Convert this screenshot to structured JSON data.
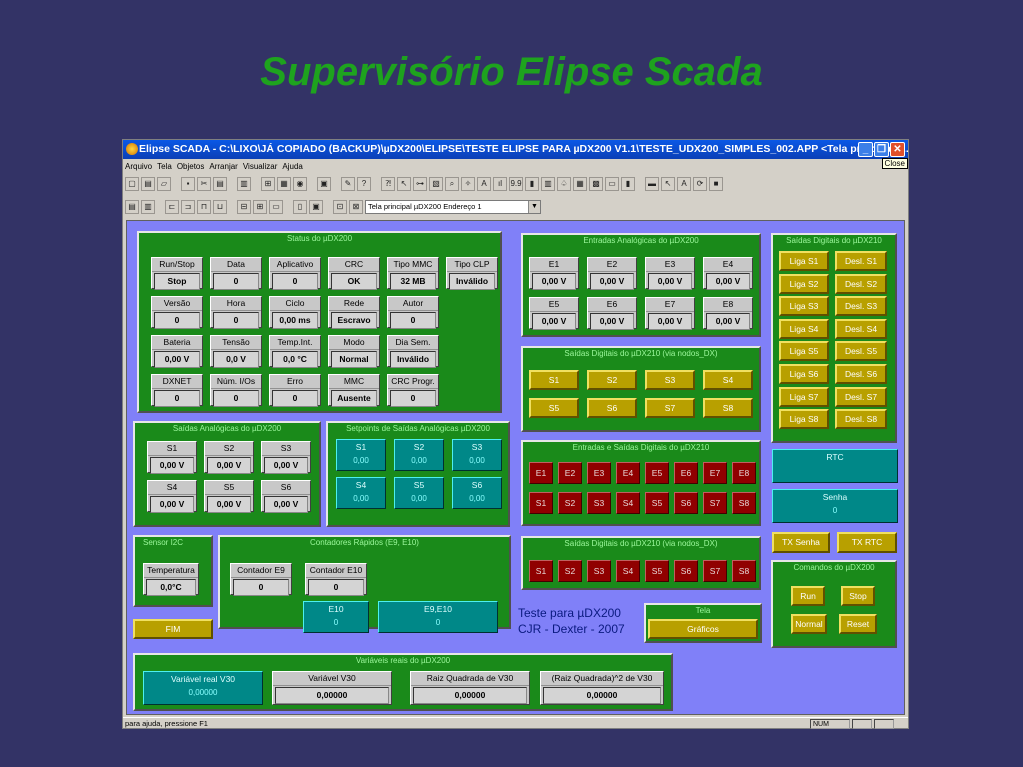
{
  "slide": {
    "title": "Supervisório Elipse Scada"
  },
  "window": {
    "title": "Elipse SCADA - C:\\LIXO\\JÁ COPIADO (BACKUP)\\µDX200\\ELIPSE\\TESTE ELIPSE PARA µDX200 V1.1\\TESTE_UDX200_SIMPLES_002.APP <Tela principal µ...",
    "minimize": "_",
    "maximize": "❐",
    "close": "✕",
    "close_tooltip": "Close",
    "menu": [
      "Arquivo",
      "Tela",
      "Objetos",
      "Arranjar",
      "Visualizar",
      "Ajuda"
    ],
    "screen_select": "Tela principal µDX200 Endereço 1",
    "status_text": "para ajuda, pressione F1",
    "status_num": "NUM"
  },
  "toolbar1_icons": [
    "new-screen-icon",
    "new-file-icon",
    "open-icon",
    "save-icon",
    "cut-icon",
    "copy-icon",
    "paste-icon",
    "tags-icon",
    "print-preview-icon",
    "camera-icon",
    "app-browser-icon",
    "tools-icon",
    "help-icon",
    "context-help-icon",
    "pointer-icon",
    "button-tool-icon",
    "gauge-tool-icon",
    "display-tool-icon",
    "animation-tool-icon",
    "text-tool-icon",
    "bar-tool-icon",
    "value-tool-icon",
    "table-tool-icon",
    "trend-tool-icon",
    "alarm-tool-icon",
    "browser-tool-icon",
    "picture-tool-icon",
    "setpoint-tool-icon",
    "video-tool-icon",
    "slider-tool-icon",
    "cursor-disabled-icon",
    "text-disabled-icon",
    "rotate-disabled-icon",
    "stop-disabled-icon"
  ],
  "toolbar1_glyphs": [
    "▢",
    "▤",
    "▱",
    "▪",
    "✂",
    "▤",
    "▥",
    "⊞",
    "▦",
    "◉",
    "▣",
    "✎",
    "?",
    "⁈",
    "↖",
    "⊶",
    "▧",
    "⌕",
    "✧",
    "A",
    "ıl",
    "9.9",
    "▮",
    "▥",
    "♤",
    "▦",
    "▩",
    "▭",
    "▮",
    "▬",
    "↖",
    "A",
    "⟳",
    "■"
  ],
  "toolbar2_icons": [
    "align-left-icon",
    "align-right-icon",
    "align-top-icon",
    "align-bottom-icon",
    "align-center-icon",
    "align-middle-icon",
    "space-h-icon",
    "space-v-icon",
    "same-width-icon",
    "same-height-icon",
    "same-size-icon",
    "group-icon",
    "ungroup-icon"
  ],
  "toolbar2_glyphs": [
    "▤",
    "▥",
    "⊏",
    "⊐",
    "⊓",
    "⊔",
    "⊟",
    "⊞",
    "▭",
    "▯",
    "▣",
    "⊡",
    "⊠"
  ],
  "status_panel": {
    "title": "Status do µDX200",
    "rows": [
      [
        {
          "label": "Run/Stop",
          "value": "Stop"
        },
        {
          "label": "Data",
          "value": "0"
        },
        {
          "label": "Aplicativo",
          "value": "0"
        },
        {
          "label": "CRC",
          "value": "OK"
        },
        {
          "label": "Tipo MMC",
          "value": "32 MB"
        },
        {
          "label": "Tipo CLP",
          "value": "Inválido"
        }
      ],
      [
        {
          "label": "Versão",
          "value": "0"
        },
        {
          "label": "Hora",
          "value": "0"
        },
        {
          "label": "Ciclo",
          "value": "0,00 ms"
        },
        {
          "label": "Rede",
          "value": "Escravo"
        },
        {
          "label": "Autor",
          "value": "0"
        }
      ],
      [
        {
          "label": "Bateria",
          "value": "0,00 V"
        },
        {
          "label": "Tensão",
          "value": "0,0 V"
        },
        {
          "label": "Temp.Int.",
          "value": "0,0 °C"
        },
        {
          "label": "Modo",
          "value": "Normal"
        },
        {
          "label": "Dia Sem.",
          "value": "Inválido"
        }
      ],
      [
        {
          "label": "DXNET",
          "value": "0"
        },
        {
          "label": "Núm. I/Os",
          "value": "0"
        },
        {
          "label": "Erro",
          "value": "0"
        },
        {
          "label": "MMC",
          "value": "Ausente"
        },
        {
          "label": "CRC Progr.",
          "value": "0"
        }
      ]
    ]
  },
  "analog_inputs": {
    "title": "Entradas Analógicas do µDX200",
    "items": [
      {
        "label": "E1",
        "value": "0,00 V"
      },
      {
        "label": "E2",
        "value": "0,00 V"
      },
      {
        "label": "E3",
        "value": "0,00 V"
      },
      {
        "label": "E4",
        "value": "0,00 V"
      },
      {
        "label": "E5",
        "value": "0,00 V"
      },
      {
        "label": "E6",
        "value": "0,00 V"
      },
      {
        "label": "E7",
        "value": "0,00 V"
      },
      {
        "label": "E8",
        "value": "0,00 V"
      }
    ]
  },
  "digital_out_nodos": {
    "title": "Saídas Digitais do µDX210 (via nodos_DX)",
    "items": [
      "S1",
      "S2",
      "S3",
      "S4",
      "S5",
      "S6",
      "S7",
      "S8"
    ]
  },
  "digital_out_panel": {
    "title": "Saídas Digitais do µDX210",
    "liga": [
      "Liga S1",
      "Liga S2",
      "Liga S3",
      "Liga S4",
      "Liga S5",
      "Liga S6",
      "Liga S7",
      "Liga S8"
    ],
    "desl": [
      "Desl. S1",
      "Desl. S2",
      "Desl. S3",
      "Desl. S4",
      "Desl. S5",
      "Desl. S6",
      "Desl. S7",
      "Desl. S8"
    ]
  },
  "analog_outputs": {
    "title": "Saídas Analógicas do µDX200",
    "items": [
      {
        "label": "S1",
        "value": "0,00 V"
      },
      {
        "label": "S2",
        "value": "0,00 V"
      },
      {
        "label": "S3",
        "value": "0,00 V"
      },
      {
        "label": "S4",
        "value": "0,00 V"
      },
      {
        "label": "S5",
        "value": "0,00 V"
      },
      {
        "label": "S6",
        "value": "0,00 V"
      }
    ]
  },
  "setpoints": {
    "title": "Setpoints de Saídas Analógicas µDX200",
    "items": [
      {
        "label": "S1",
        "value": "0,00"
      },
      {
        "label": "S2",
        "value": "0,00"
      },
      {
        "label": "S3",
        "value": "0,00"
      },
      {
        "label": "S4",
        "value": "0,00"
      },
      {
        "label": "S5",
        "value": "0,00"
      },
      {
        "label": "S6",
        "value": "0,00"
      }
    ]
  },
  "io_digital": {
    "title": "Entradas e Saídas Digitais do µDX210",
    "inputs": [
      "E1",
      "E2",
      "E3",
      "E4",
      "E5",
      "E6",
      "E7",
      "E8"
    ],
    "outputs": [
      "S1",
      "S2",
      "S3",
      "S4",
      "S5",
      "S6",
      "S7",
      "S8"
    ]
  },
  "digital_out_nodos2": {
    "title": "Saídas Digitais do µDX210 (via nodos_DX)",
    "items": [
      "S1",
      "S2",
      "S3",
      "S4",
      "S5",
      "S6",
      "S7",
      "S8"
    ]
  },
  "rtc": {
    "label": "RTC",
    "value": ""
  },
  "senha": {
    "label": "Senha",
    "value": "0"
  },
  "tx_senha": "TX Senha",
  "tx_rtc": "TX RTC",
  "comandos": {
    "title": "Comandos do µDX200",
    "run": "Run",
    "stop": "Stop",
    "normal": "Normal",
    "reset": "Reset"
  },
  "sensor": {
    "title": "Sensor I2C",
    "label": "Temperatura",
    "value": "0,0°C"
  },
  "counters": {
    "title": "Contadores Rápidos (E9, E10)",
    "c9": {
      "label": "Contador E9",
      "value": "0"
    },
    "c10": {
      "label": "Contador E10",
      "value": "0"
    },
    "e10": {
      "label": "E10",
      "value": "0"
    },
    "e9e10": {
      "label": "E9,E10",
      "value": "0"
    }
  },
  "fim": "FIM",
  "teste": {
    "line1": "Teste para µDX200",
    "line2": "CJR - Dexter - 2007"
  },
  "tela": {
    "title": "Tela",
    "button": "Gráficos"
  },
  "real_vars": {
    "title": "Variáveis reais do µDX200",
    "v30_set": {
      "label": "Variável real V30",
      "value": "0,00000"
    },
    "v30": {
      "label": "Variável V30",
      "value": "0,00000"
    },
    "sqrt": {
      "label": "Raiz Quadrada de V30",
      "value": "0,00000"
    },
    "sqrt2": {
      "label": "(Raiz Quadrada)^2 de V30",
      "value": "0,00000"
    }
  }
}
